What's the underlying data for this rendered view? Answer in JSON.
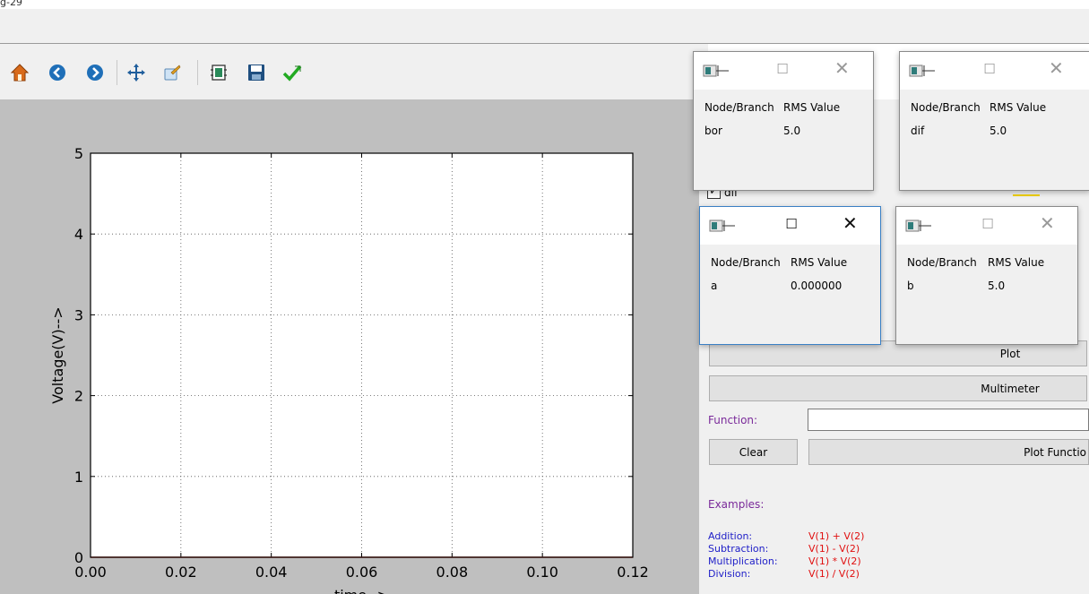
{
  "window": {
    "title_fragment": "g-29"
  },
  "toolbar": {
    "icons": [
      "home-icon",
      "back-icon",
      "forward-icon",
      "pan-icon",
      "zoom-icon",
      "subplots-icon",
      "save-icon",
      "edit-curves-icon"
    ],
    "accent_colors": {
      "home": "#d86a1a",
      "nav": "#1f6fb8",
      "check": "#22aa22"
    }
  },
  "chart_data": {
    "type": "line",
    "title": "",
    "xlabel": "time-->",
    "ylabel": "Voltage(V)-->",
    "xlim": [
      0.0,
      0.12
    ],
    "ylim": [
      0,
      5
    ],
    "x_ticks": [
      "0.00",
      "0.02",
      "0.04",
      "0.06",
      "0.08",
      "0.10",
      "0.12"
    ],
    "y_ticks": [
      "0",
      "1",
      "2",
      "3",
      "4",
      "5"
    ],
    "grid": true,
    "series": [
      {
        "color": "#c0392b",
        "x": [
          0.0,
          0.12
        ],
        "y": [
          0,
          0
        ]
      }
    ]
  },
  "panel": {
    "checkbox_label": "dif",
    "checkbox_checked": true,
    "plot_button": "Plot",
    "multimeter_button": "Multimeter",
    "function_label": "Function:",
    "function_value": "",
    "clear_button": "Clear",
    "plot_function_button": "Plot Functio",
    "examples_label": "Examples:",
    "examples": [
      {
        "name": "Addition:",
        "expr": "V(1) + V(2)"
      },
      {
        "name": "Subtraction:",
        "expr": "V(1) - V(2)"
      },
      {
        "name": "Multiplication:",
        "expr": "V(1) * V(2)"
      },
      {
        "name": "Division:",
        "expr": "V(1) / V(2)"
      }
    ]
  },
  "dialogs": [
    {
      "header_node": "Node/Branch",
      "header_rms": "RMS Value",
      "node": "bor",
      "value": "5.0",
      "active": false
    },
    {
      "header_node": "Node/Branch",
      "header_rms": "RMS Value",
      "node": "dif",
      "value": "5.0",
      "active": false
    },
    {
      "header_node": "Node/Branch",
      "header_rms": "RMS Value",
      "node": "a",
      "value": "0.000000",
      "active": true
    },
    {
      "header_node": "Node/Branch",
      "header_rms": "RMS Value",
      "node": "b",
      "value": "5.0",
      "active": false
    }
  ],
  "glyphs": {
    "maximize": "☐",
    "close": "✕",
    "check": "✓"
  }
}
